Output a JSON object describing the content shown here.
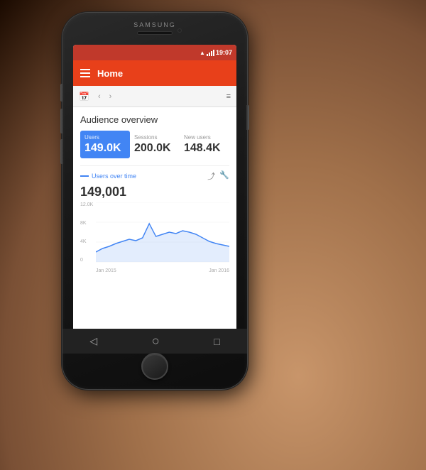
{
  "device": {
    "brand": "SAMSUNG",
    "status_bar": {
      "time": "19:07"
    }
  },
  "app_bar": {
    "title": "Home"
  },
  "nav": {
    "back_label": "‹",
    "forward_label": "›",
    "filter_label": "≡"
  },
  "content": {
    "section_title": "Audience overview",
    "metrics": [
      {
        "label": "Users",
        "value": "149.0K",
        "active": true
      },
      {
        "label": "Sessions",
        "value": "200.0K",
        "active": false
      },
      {
        "label": "New users",
        "value": "148.4K",
        "active": false
      }
    ],
    "chart": {
      "label": "Users over time",
      "value": "149,001",
      "y_labels": [
        "12.0K",
        "8K",
        "4K",
        "0"
      ],
      "x_labels": [
        "Jan 2015",
        "Jan 2016"
      ]
    }
  },
  "bottom_nav": {
    "back_icon": "◁",
    "home_icon": "○",
    "recents_icon": "□"
  }
}
